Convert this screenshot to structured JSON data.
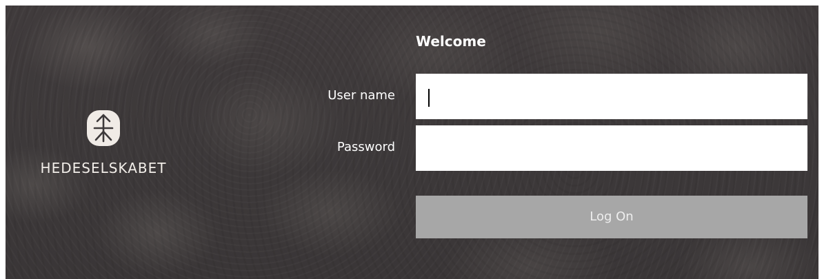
{
  "brand": {
    "name": "HEDESELSKABET",
    "emblem_icon": "tree-arrow-emblem-icon",
    "emblem_color": "#f0ebe6"
  },
  "login": {
    "heading": "Welcome",
    "username_label": "User name",
    "username_value": "",
    "password_label": "Password",
    "password_value": "",
    "submit_label": "Log On"
  },
  "colors": {
    "background": "#3d393a",
    "button": "#a7a7a7",
    "field": "#ffffff",
    "text": "#ffffff"
  }
}
